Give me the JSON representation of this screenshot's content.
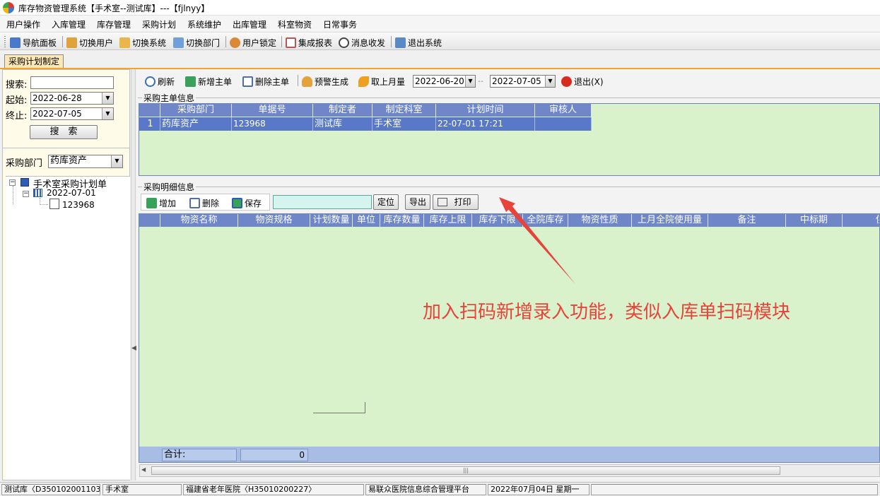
{
  "window": {
    "title": "库存物资管理系统【手术室--测试库】---【fjlnyy】"
  },
  "menu": [
    "用户操作",
    "入库管理",
    "库存管理",
    "采购计划",
    "系统维护",
    "出库管理",
    "科室物资",
    "日常事务"
  ],
  "toolbar": [
    {
      "label": "导航面板",
      "icon": "navigation-panel-icon",
      "color": "#4a79c9"
    },
    {
      "label": "切换用户",
      "icon": "switch-user-icon",
      "color": "#e0a23a"
    },
    {
      "label": "切换系统",
      "icon": "switch-system-icon",
      "color": "#e8b64a"
    },
    {
      "label": "切换部门",
      "icon": "switch-department-icon",
      "color": "#6fa0d8"
    },
    {
      "label": "用户锁定",
      "icon": "user-lock-icon",
      "color": "#d9893a"
    },
    {
      "label": "集成报表",
      "icon": "integrated-report-icon",
      "color": "#b85555"
    },
    {
      "label": "消息收发",
      "icon": "message-icon",
      "color": "#444444"
    },
    {
      "label": "退出系统",
      "icon": "exit-system-icon",
      "color": "#5a8ac4"
    }
  ],
  "tab": {
    "label": "采购计划制定"
  },
  "left": {
    "search_label": "搜索:",
    "search_value": "",
    "start_label": "起始:",
    "start_value": "2022-06-28",
    "end_label": "终止:",
    "end_value": "2022-07-05",
    "search_button": "搜　索",
    "dept_label": "采购部门",
    "dept_value": "药库资产",
    "tree": {
      "root": "手术室采购计划单",
      "date": "2022-07-01",
      "doc": "123968"
    }
  },
  "right_toolbar": {
    "refresh": "刷新",
    "add_master": "新增主单",
    "delete_master": "删除主单",
    "alert_generate": "预警生成",
    "last_month": "取上月量",
    "date_from": "2022-06-20",
    "date_sep": "--",
    "date_to": "2022-07-05",
    "exit": "退出(X)"
  },
  "master": {
    "title": "采购主单信息",
    "columns": [
      "采购部门",
      "单据号",
      "制定者",
      "制定科室",
      "计划时间",
      "审核人"
    ],
    "rows": [
      {
        "index": "1",
        "cells": [
          "药库资产",
          "123968",
          "测试库",
          "手术室",
          "22-07-01 17:21",
          ""
        ]
      }
    ]
  },
  "detail": {
    "title": "采购明细信息",
    "add": "增加",
    "delete": "删除",
    "save": "保存",
    "locate_input": "",
    "locate": "定位",
    "export": "导出",
    "print": "打印",
    "columns": [
      "物资名称",
      "物资规格",
      "计划数量",
      "单位",
      "库存数量",
      "库存上限",
      "库存下限",
      "全院库存",
      "物资性质",
      "上月全院使用量",
      "备注",
      "中标期",
      "供"
    ],
    "total_label": "合计:",
    "total_value": "0"
  },
  "status": [
    "测试库〈D350102001103〉",
    "手术室",
    "福建省老年医院〈H35010200227〉",
    "易联众医院信息综合管理平台",
    "2022年07月04日 星期一"
  ],
  "annotation": {
    "text": "加入扫码新增录入功能，类似入库单扫码模块",
    "color": "#e8433a"
  }
}
